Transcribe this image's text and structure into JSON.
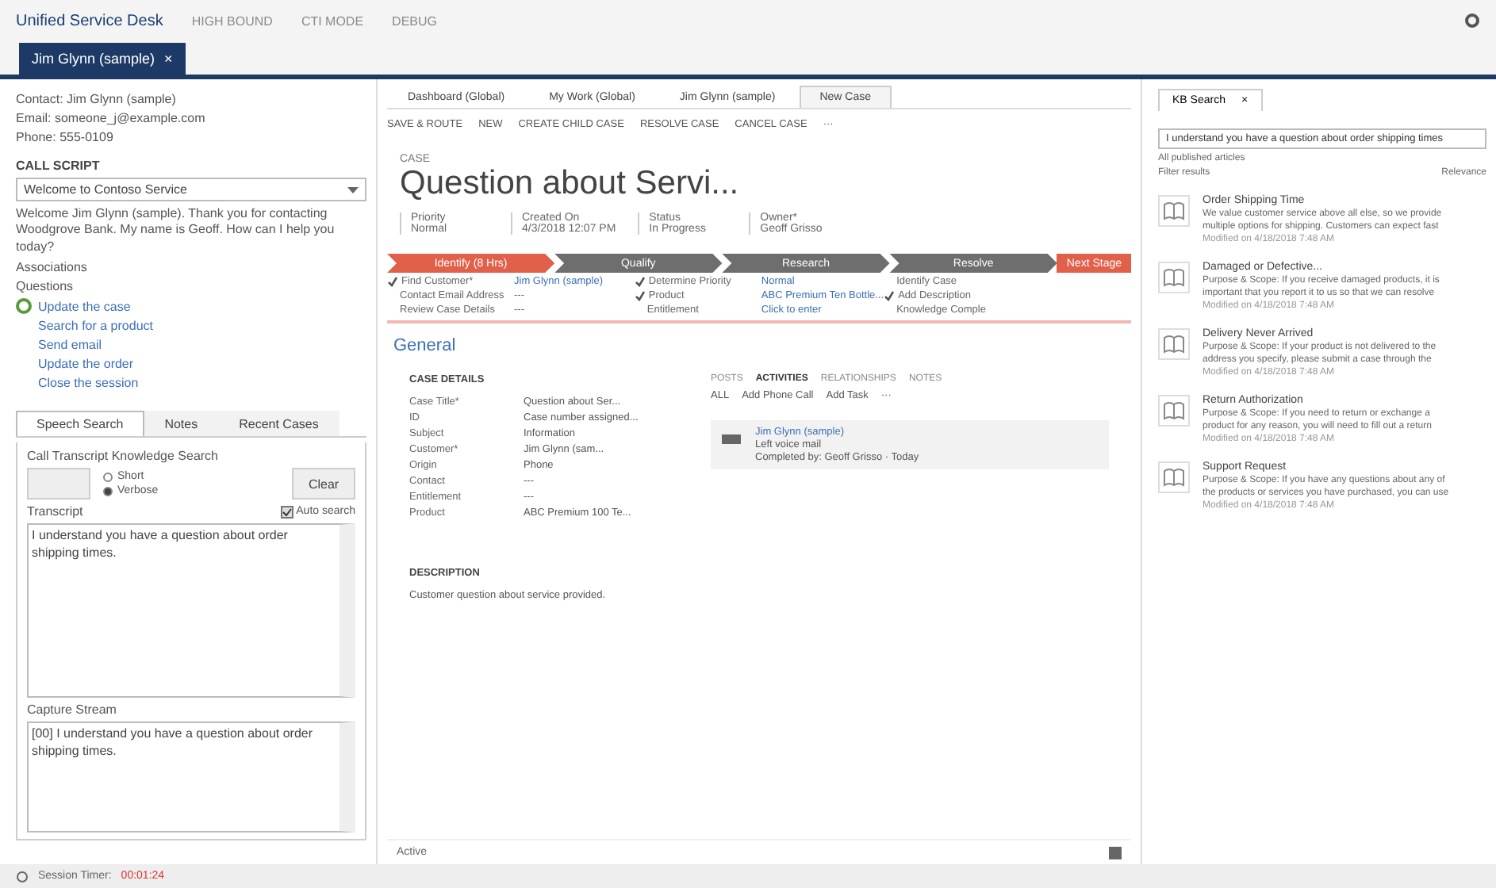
{
  "app": {
    "title": "Unified Service Desk",
    "nav": [
      "HIGH BOUND",
      "CTI MODE",
      "DEBUG"
    ]
  },
  "session_tab": {
    "label": "Jim Glynn (sample)",
    "close": "×",
    "selected": true
  },
  "left": {
    "contact": "Contact: Jim Glynn (sample)",
    "email": "Email: someone_j@example.com",
    "phone": "Phone: 555-0109",
    "script_heading": "CALL SCRIPT",
    "script_select": "Welcome to Contoso Service",
    "script_text": "Welcome Jim Glynn (sample). Thank you for contacting Woodgrove Bank. My name is Geoff. How can I help you today?",
    "associations": "Associations",
    "answer": "Questions",
    "actions": [
      {
        "label": "Update the case",
        "done": true
      },
      {
        "label": "Search for a product",
        "done": false
      },
      {
        "label": "Send email",
        "done": false
      },
      {
        "label": "Update the order",
        "done": false
      },
      {
        "label": "Close the session",
        "done": false
      }
    ],
    "tabs": [
      {
        "label": "Speech Search",
        "selected": true
      },
      {
        "label": "Notes",
        "selected": false
      },
      {
        "label": "Recent Cases",
        "selected": false
      }
    ],
    "group": "Call Transcript Knowledge Search",
    "modes": [
      {
        "label": "Short",
        "selected": false
      },
      {
        "label": "Verbose",
        "selected": true
      }
    ],
    "clear": "Clear",
    "transcript_label": "Transcript",
    "auto_search": {
      "label": "Auto search",
      "checked": true
    },
    "transcript": "I understand you have a question about order shipping times.",
    "capture_label": "Capture Stream",
    "capture": "[00] I understand you have a question about order shipping times."
  },
  "status_bar": {
    "label": "Session Timer:",
    "value": "00:01:24"
  },
  "center": {
    "tabs": [
      {
        "label": "Dashboard (Global)",
        "selected": false
      },
      {
        "label": "My Work (Global)",
        "selected": false
      },
      {
        "label": "Jim Glynn (sample)",
        "selected": false
      },
      {
        "label": "New Case",
        "selected": true
      }
    ],
    "toolbar": [
      "SAVE & ROUTE",
      "NEW",
      "CREATE CHILD CASE",
      "RESOLVE CASE",
      "CANCEL CASE",
      "···"
    ],
    "entity": "CASE",
    "title": "Question about Servi...",
    "header": [
      {
        "label": "Priority",
        "value": "Normal"
      },
      {
        "label": "Created On",
        "value": "4/3/2018  12:07 PM"
      },
      {
        "label": "Status",
        "value": "In Progress"
      },
      {
        "label": "Owner*",
        "value": "Geoff Grisso"
      }
    ],
    "stages": [
      {
        "label": "Identify (8 Hrs)",
        "selected": true
      },
      {
        "label": "Qualify",
        "selected": false
      },
      {
        "label": "Research",
        "selected": false
      },
      {
        "label": "Resolve",
        "selected": false
      }
    ],
    "next_stage": "Next Stage",
    "stage_columns": [
      [
        {
          "label": "Find Customer*",
          "value": "Jim Glynn (sample)",
          "done": true
        },
        {
          "label": "Contact Email Address",
          "value": "---",
          "done": false
        },
        {
          "label": "Review Case Details",
          "value": "---",
          "done": false
        }
      ],
      [
        {
          "label": "Determine Priority",
          "value": "Normal",
          "done": true
        },
        {
          "label": "Product",
          "value": "ABC Premium Ten Bottle...",
          "done": true
        },
        {
          "label": "Entitlement",
          "value": "Click to enter",
          "done": false
        }
      ],
      [
        {
          "label": "Identify Case",
          "done": false
        },
        {
          "label": "Add Description",
          "done": true
        },
        {
          "label": "Knowledge Comple",
          "done": false
        }
      ]
    ],
    "section": "General",
    "details_heading": "CASE DETAILS",
    "details": [
      {
        "label": "Case Title*",
        "value": "Question about Ser..."
      },
      {
        "label": "ID",
        "value": "Case number assigned..."
      },
      {
        "label": "Subject",
        "value": "Information"
      },
      {
        "label": "Customer*",
        "value": "Jim Glynn (sam..."
      },
      {
        "label": "Origin",
        "value": "Phone"
      },
      {
        "label": "Contact",
        "value": "---"
      },
      {
        "label": "Entitlement",
        "value": "---"
      },
      {
        "label": "Product",
        "value": "ABC Premium 100 Te..."
      }
    ],
    "feed_tabs": [
      {
        "label": "POSTS",
        "selected": false
      },
      {
        "label": "ACTIVITIES",
        "selected": true
      },
      {
        "label": "RELATIONSHIPS",
        "selected": false
      },
      {
        "label": "NOTES",
        "selected": false
      }
    ],
    "feed_actions": [
      "ALL",
      "Add Phone Call",
      "Add Task",
      "···"
    ],
    "activity": {
      "who": "Jim Glynn (sample)",
      "what": "Left voice mail",
      "by": "Completed by: Geoff Grisso · Today"
    },
    "description_heading": "DESCRIPTION",
    "description": "Customer question about service provided.",
    "footer": "Active"
  },
  "right": {
    "tab": "KB Search",
    "close": "×",
    "query": "I understand you have a question about order shipping times",
    "scope": "All published articles",
    "filter": "Filter results",
    "sort": "Relevance",
    "articles": [
      {
        "title": "Order Shipping Time",
        "lines": [
          "We value customer service above all else, so we provide",
          "multiple options for shipping. Customers can expect fast"
        ],
        "meta": "Modified on 4/18/2018 7:48 AM"
      },
      {
        "title": "Damaged or Defective...",
        "lines": [
          "Purpose & Scope: If you receive damaged products, it is",
          "important that you report it to us so that we can resolve"
        ],
        "meta": "Modified on 4/18/2018 7:48 AM"
      },
      {
        "title": "Delivery Never Arrived",
        "lines": [
          "Purpose & Scope: If your product is not delivered to the",
          "address you specify, please submit a case through the"
        ],
        "meta": "Modified on 4/18/2018 7:48 AM"
      },
      {
        "title": "Return Authorization",
        "lines": [
          "Purpose & Scope: If you need to return or exchange a",
          "product for any reason, you will need to fill out a return"
        ],
        "meta": "Modified on 4/18/2018 7:48 AM"
      },
      {
        "title": "Support Request",
        "lines": [
          "Purpose & Scope: If you have any questions about any of",
          "the products or services you have purchased, you can use"
        ],
        "meta": "Modified on 4/18/2018 7:48 AM"
      }
    ]
  }
}
